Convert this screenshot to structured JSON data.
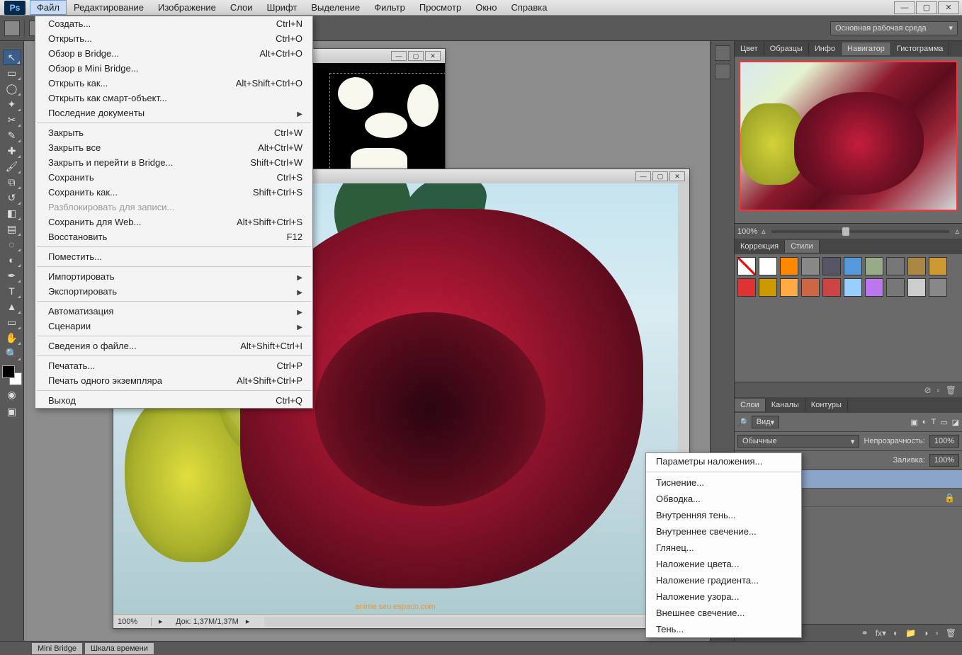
{
  "app": {
    "logo": "Ps"
  },
  "menubar": {
    "items": [
      "Файл",
      "Редактирование",
      "Изображение",
      "Слои",
      "Шрифт",
      "Выделение",
      "Фильтр",
      "Просмотр",
      "Окно",
      "Справка"
    ],
    "active_index": 0
  },
  "window_buttons": {
    "min": "—",
    "max": "▢",
    "close": "✕"
  },
  "options_bar": {
    "workspace_label": "Основная рабочая среда"
  },
  "tools": [
    {
      "name": "move",
      "glyph": "↖"
    },
    {
      "name": "marquee",
      "glyph": "▭"
    },
    {
      "name": "lasso",
      "glyph": "◯"
    },
    {
      "name": "wand",
      "glyph": "✦"
    },
    {
      "name": "crop",
      "glyph": "✂"
    },
    {
      "name": "eyedropper",
      "glyph": "✎"
    },
    {
      "name": "healing",
      "glyph": "✚"
    },
    {
      "name": "brush",
      "glyph": "🖌"
    },
    {
      "name": "stamp",
      "glyph": "⧉"
    },
    {
      "name": "history-brush",
      "glyph": "↺"
    },
    {
      "name": "eraser",
      "glyph": "◧"
    },
    {
      "name": "gradient",
      "glyph": "▤"
    },
    {
      "name": "blur",
      "glyph": "◌"
    },
    {
      "name": "dodge",
      "glyph": "◐"
    },
    {
      "name": "pen",
      "glyph": "✒"
    },
    {
      "name": "type",
      "glyph": "T"
    },
    {
      "name": "path-select",
      "glyph": "▲"
    },
    {
      "name": "shape",
      "glyph": "▭"
    },
    {
      "name": "hand",
      "glyph": "✋"
    },
    {
      "name": "zoom",
      "glyph": "🔍"
    }
  ],
  "file_menu": [
    {
      "label": "Создать...",
      "shortcut": "Ctrl+N"
    },
    {
      "label": "Открыть...",
      "shortcut": "Ctrl+O"
    },
    {
      "label": "Обзор в Bridge...",
      "shortcut": "Alt+Ctrl+O"
    },
    {
      "label": "Обзор в Mini Bridge..."
    },
    {
      "label": "Открыть как...",
      "shortcut": "Alt+Shift+Ctrl+O"
    },
    {
      "label": "Открыть как смарт-объект..."
    },
    {
      "label": "Последние документы",
      "submenu": true
    },
    {
      "sep": true
    },
    {
      "label": "Закрыть",
      "shortcut": "Ctrl+W"
    },
    {
      "label": "Закрыть все",
      "shortcut": "Alt+Ctrl+W"
    },
    {
      "label": "Закрыть и перейти в Bridge...",
      "shortcut": "Shift+Ctrl+W"
    },
    {
      "label": "Сохранить",
      "shortcut": "Ctrl+S"
    },
    {
      "label": "Сохранить как...",
      "shortcut": "Shift+Ctrl+S"
    },
    {
      "label": "Разблокировать для записи...",
      "disabled": true
    },
    {
      "label": "Сохранить для Web...",
      "shortcut": "Alt+Shift+Ctrl+S"
    },
    {
      "label": "Восстановить",
      "shortcut": "F12"
    },
    {
      "sep": true
    },
    {
      "label": "Поместить..."
    },
    {
      "sep": true
    },
    {
      "label": "Импортировать",
      "submenu": true
    },
    {
      "label": "Экспортировать",
      "submenu": true
    },
    {
      "sep": true
    },
    {
      "label": "Автоматизация",
      "submenu": true
    },
    {
      "label": "Сценарии",
      "submenu": true
    },
    {
      "sep": true
    },
    {
      "label": "Сведения о файле...",
      "shortcut": "Alt+Shift+Ctrl+I"
    },
    {
      "sep": true
    },
    {
      "label": "Печатать...",
      "shortcut": "Ctrl+P"
    },
    {
      "label": "Печать одного экземпляра",
      "shortcut": "Alt+Shift+Ctrl+P"
    },
    {
      "sep": true
    },
    {
      "label": "Выход",
      "shortcut": "Ctrl+Q"
    }
  ],
  "fx_menu": [
    {
      "label": "Параметры наложения..."
    },
    {
      "sep": true
    },
    {
      "label": "Тиснение..."
    },
    {
      "label": "Обводка..."
    },
    {
      "label": "Внутренняя тень..."
    },
    {
      "label": "Внутреннее свечение..."
    },
    {
      "label": "Глянец..."
    },
    {
      "label": "Наложение цвета..."
    },
    {
      "label": "Наложение градиента..."
    },
    {
      "label": "Наложение узора..."
    },
    {
      "label": "Внешнее свечение..."
    },
    {
      "label": "Тень..."
    }
  ],
  "doc1": {
    "zoom": "100%",
    "status": "Док: 1,37M/1,37M",
    "watermark": "anime seu espaco.com"
  },
  "doc2": {
    "min": "—",
    "max": "▢",
    "close": "✕"
  },
  "doc1_btns": {
    "min": "—",
    "max": "▢",
    "close": "✕"
  },
  "right_panels": {
    "top_tabs": [
      "Цвет",
      "Образцы",
      "Инфо",
      "Навигатор",
      "Гистограмма"
    ],
    "top_active": 3,
    "nav_zoom": "100%",
    "mid_tabs": [
      "Коррекция",
      "Стили"
    ],
    "mid_active": 1,
    "style_colors": [
      "#fff",
      "#f80",
      "#888",
      "#556",
      "#59d",
      "#9a8",
      "#777",
      "#a84",
      "#c93",
      "#d33",
      "#c90",
      "#fa4",
      "#c64",
      "#c44",
      "#9cf",
      "#b7e",
      "#777",
      "#ccc",
      "#888"
    ],
    "layers_tabs": [
      "Слои",
      "Каналы",
      "Контуры"
    ],
    "layers_active": 0,
    "filter_label": "Вид",
    "blend_label": "Обычные",
    "opacity_label": "Непрозрачность:",
    "opacity_value": "100%",
    "fill_label": "Заливка:",
    "fill_value": "100%",
    "search_glyph": "🔎"
  },
  "bottom_tabs": [
    "Mini Bridge",
    "Шкала времени"
  ]
}
